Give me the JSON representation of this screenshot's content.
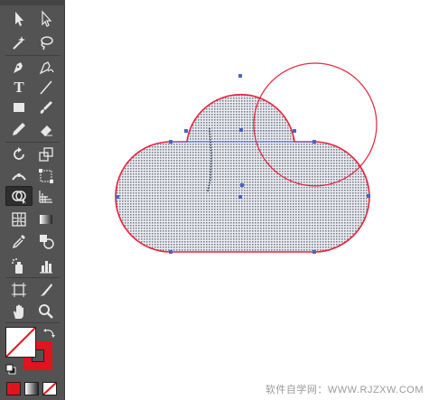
{
  "toolbar": {
    "tools": [
      {
        "id": "selection",
        "icon": "selection-arrow-icon"
      },
      {
        "id": "direct-selection",
        "icon": "direct-selection-arrow-icon"
      },
      {
        "id": "magic-wand",
        "icon": "magic-wand-icon"
      },
      {
        "id": "lasso",
        "icon": "lasso-icon"
      },
      {
        "id": "pen",
        "icon": "pen-icon"
      },
      {
        "id": "curvature",
        "icon": "curvature-icon"
      },
      {
        "id": "type",
        "icon": "type-icon",
        "glyph": "T"
      },
      {
        "id": "line-segment",
        "icon": "line-segment-icon"
      },
      {
        "id": "rectangle",
        "icon": "rectangle-icon"
      },
      {
        "id": "paintbrush",
        "icon": "paintbrush-icon"
      },
      {
        "id": "pencil",
        "icon": "pencil-icon"
      },
      {
        "id": "eraser",
        "icon": "eraser-icon"
      },
      {
        "id": "rotate",
        "icon": "rotate-icon"
      },
      {
        "id": "scale",
        "icon": "scale-icon"
      },
      {
        "id": "width",
        "icon": "width-icon"
      },
      {
        "id": "free-transform",
        "icon": "free-transform-icon"
      },
      {
        "id": "shape-builder",
        "icon": "shape-builder-icon",
        "active": true
      },
      {
        "id": "perspective-grid",
        "icon": "perspective-grid-icon"
      },
      {
        "id": "mesh",
        "icon": "mesh-icon"
      },
      {
        "id": "gradient",
        "icon": "gradient-icon"
      },
      {
        "id": "eyedropper",
        "icon": "eyedropper-icon"
      },
      {
        "id": "blend",
        "icon": "blend-icon"
      },
      {
        "id": "symbol-sprayer",
        "icon": "symbol-sprayer-icon"
      },
      {
        "id": "column-graph",
        "icon": "column-graph-icon"
      },
      {
        "id": "artboard",
        "icon": "artboard-icon"
      },
      {
        "id": "slice",
        "icon": "slice-icon"
      },
      {
        "id": "hand",
        "icon": "hand-icon"
      },
      {
        "id": "zoom",
        "icon": "zoom-icon"
      }
    ],
    "fill_color": "none",
    "stroke_color": "#e0141e",
    "mode_fill_color": "#e0141e"
  },
  "watermark": "软件自学网：WWW.RJZXW.COM",
  "colors": {
    "toolbar_bg": "#535353",
    "shape_stroke": "#e8213c",
    "anchor": "#4a64c8"
  }
}
